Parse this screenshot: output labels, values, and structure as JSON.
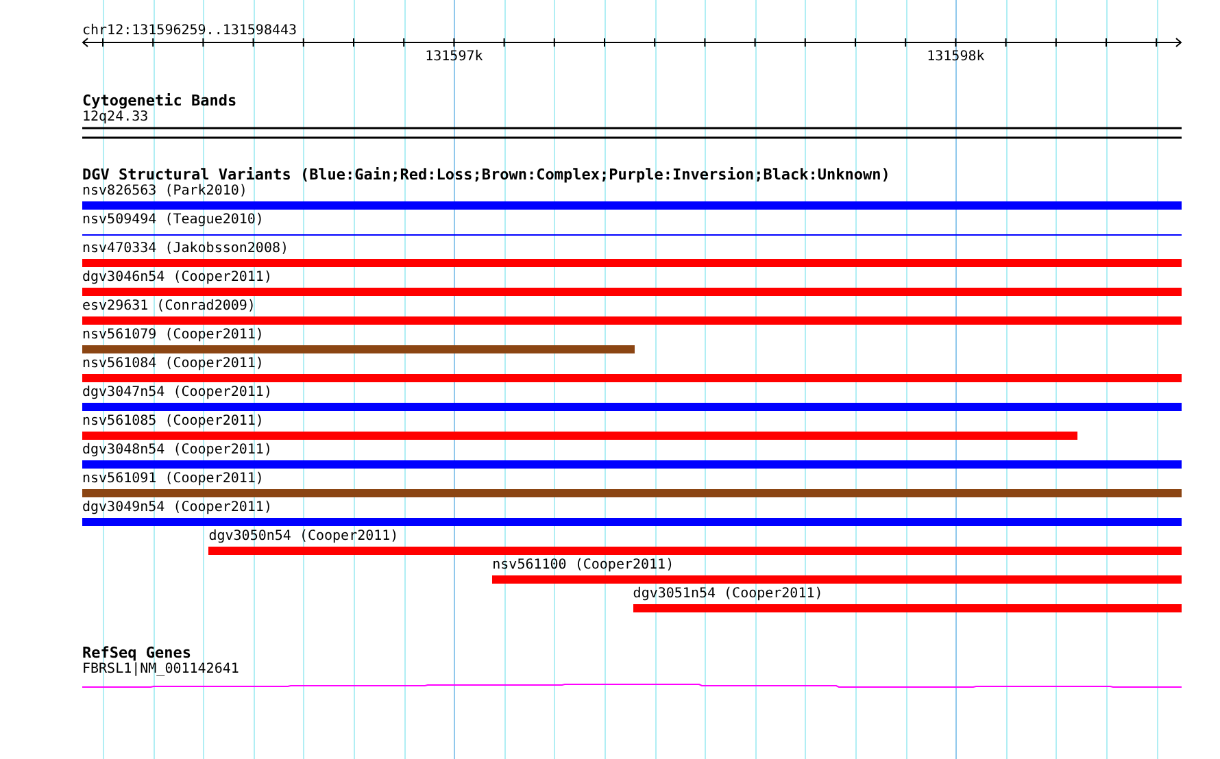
{
  "ruler": {
    "range": "chr12:131596259..131598443",
    "ticks": [
      "131597k",
      "131598k"
    ]
  },
  "cytogenetic_bands": {
    "title": "Cytogenetic Bands",
    "band": "12q24.33"
  },
  "dgv_track": {
    "title": "DGV Structural Variants (Blue:Gain;Red:Loss;Brown:Complex;Purple:Inversion;Black:Unknown)",
    "variants": [
      {
        "label": "nsv826563 (Park2010)",
        "kind": "bar",
        "color": "#0000ff"
      },
      {
        "label": "nsv509494 (Teague2010)",
        "kind": "line",
        "color": "#0000ff"
      },
      {
        "label": "nsv470334 (Jakobsson2008)",
        "kind": "bar",
        "color": "#ff0000"
      },
      {
        "label": "dgv3046n54 (Cooper2011)",
        "kind": "bar",
        "color": "#ff0000"
      },
      {
        "label": "esv29631 (Conrad2009)",
        "kind": "bar",
        "color": "#ff0000"
      },
      {
        "label": "nsv561079 (Cooper2011)",
        "kind": "bar",
        "color": "#8b4513"
      },
      {
        "label": "nsv561084 (Cooper2011)",
        "kind": "bar",
        "color": "#ff0000"
      },
      {
        "label": "dgv3047n54 (Cooper2011)",
        "kind": "bar",
        "color": "#0000ff"
      },
      {
        "label": "nsv561085 (Cooper2011)",
        "kind": "bar",
        "color": "#ff0000"
      },
      {
        "label": "dgv3048n54 (Cooper2011)",
        "kind": "bar",
        "color": "#0000ff"
      },
      {
        "label": "nsv561091 (Cooper2011)",
        "kind": "bar",
        "color": "#8b4513"
      },
      {
        "label": "dgv3049n54 (Cooper2011)",
        "kind": "bar",
        "color": "#0000ff"
      },
      {
        "label": "dgv3050n54 (Cooper2011)",
        "kind": "bar",
        "color": "#ff0000"
      },
      {
        "label": "nsv561100 (Cooper2011)",
        "kind": "bar",
        "color": "#ff0000"
      },
      {
        "label": "dgv3051n54 (Cooper2011)",
        "kind": "bar",
        "color": "#ff0000"
      }
    ]
  },
  "refseq_genes": {
    "title": "RefSeq Genes",
    "genes": [
      {
        "label": "FBRSL1|NM_001142641"
      }
    ]
  }
}
